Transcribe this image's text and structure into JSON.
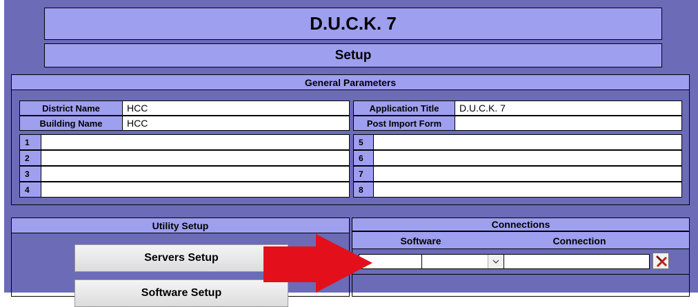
{
  "app_title": "D.U.C.K. 7",
  "page_subtitle": "Setup",
  "general": {
    "header": "General Parameters",
    "district_label": "District Name",
    "district_value": "HCC",
    "building_label": "Building Name",
    "building_value": "HCC",
    "app_title_label": "Application Title",
    "app_title_value": "D.U.C.K. 7",
    "post_import_label": "Post Import Form",
    "post_import_value": "",
    "left_rows": [
      "1",
      "2",
      "3",
      "4"
    ],
    "right_rows": [
      "5",
      "6",
      "7",
      "8"
    ]
  },
  "utility": {
    "header": "Utility Setup",
    "servers_button": "Servers Setup",
    "software_button": "Software Setup"
  },
  "connections": {
    "header": "Connections",
    "col_software": "Software",
    "col_connection": "Connection",
    "software_value": "",
    "connection_value": ""
  },
  "colors": {
    "panel": "#6b6bb8",
    "lavender": "#9f9ff0",
    "arrow": "#e3101b"
  },
  "icons": {
    "dropdown": "chevron-down-icon",
    "delete": "delete-record-icon"
  }
}
